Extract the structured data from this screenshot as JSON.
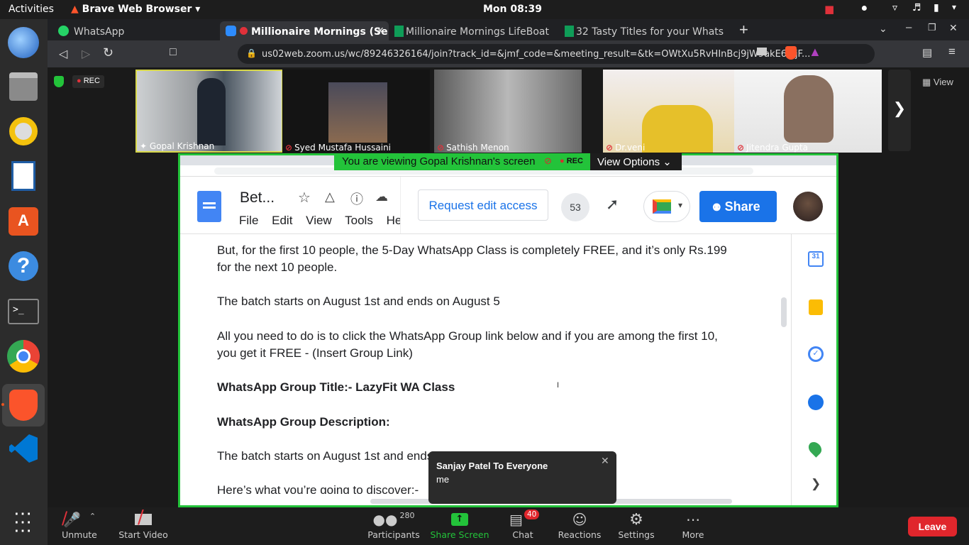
{
  "topbar": {
    "activities": "Activities",
    "app_name": "Brave Web Browser",
    "clock": "Mon 08:39"
  },
  "browser": {
    "tabs": [
      {
        "label": "WhatsApp",
        "icon": "whatsapp-icon"
      },
      {
        "label": "Millionaire Mornings (Se",
        "icon": "zoom-icon"
      },
      {
        "label": "Millionaire Mornings LifeBoat",
        "icon": "sheets-icon"
      },
      {
        "label": "32 Tasty Titles for your Whats",
        "icon": "sheets-icon"
      }
    ],
    "url": "us02web.zoom.us/wc/89246326164/join?track_id=&jmf_code=&meeting_result=&tk=OWtXu5RvHInBcj9jW9akE6l0jF..."
  },
  "meeting": {
    "rec_label": "REC",
    "view_label": "View",
    "participants": [
      {
        "name": "Gopal Krishnan",
        "muted": false
      },
      {
        "name": "Syed Mustafa Hussaini",
        "muted": true
      },
      {
        "name": "Sathish Menon",
        "muted": true
      },
      {
        "name": "Dr.veni",
        "muted": true
      },
      {
        "name": "Jitendra Gupta",
        "muted": true
      }
    ],
    "banner": "You are viewing Gopal Krishnan's screen",
    "banner_rec": "REC",
    "view_options": "View Options"
  },
  "doc": {
    "title": "Bet...",
    "menu": [
      "File",
      "Edit",
      "View",
      "Tools",
      "He"
    ],
    "request_access": "Request edit access",
    "viewer_count": "53",
    "share_label": "Share",
    "lines": [
      {
        "text": "But, for the first 10 people, the 5-Day WhatsApp Class is completely FREE, and it’s only Rs.199",
        "bold": false
      },
      {
        "text": "for the next 10 people.",
        "bold": false
      },
      {
        "text": "The batch starts on August 1st and ends on August 5",
        "bold": false
      },
      {
        "text": "All you need to do is to click the WhatsApp Group link below and if you are among the first 10,",
        "bold": false
      },
      {
        "text": "you get it FREE - (Insert Group Link)",
        "bold": false
      },
      {
        "text": "WhatsApp Group Title:- LazyFit WA Class",
        "bold": true
      },
      {
        "text": "WhatsApp Group Description:",
        "bold": true
      },
      {
        "text": "The batch starts on August 1st  and ends on August 5.",
        "bold": false
      },
      {
        "text": "Here’s what you’re going to discover:-",
        "bold": false
      }
    ]
  },
  "chat_toast": {
    "sender": "Sanjay Patel To Everyone",
    "message": "me"
  },
  "toolbar": {
    "unmute": "Unmute",
    "start_video": "Start Video",
    "participants": "Participants",
    "participants_count": "280",
    "share_screen": "Share Screen",
    "chat": "Chat",
    "chat_badge": "40",
    "reactions": "Reactions",
    "settings": "Settings",
    "more": "More",
    "leave": "Leave"
  },
  "colors": {
    "zoom_green": "#23c33a",
    "leave_red": "#e0262c",
    "docs_blue": "#1a73e8"
  }
}
